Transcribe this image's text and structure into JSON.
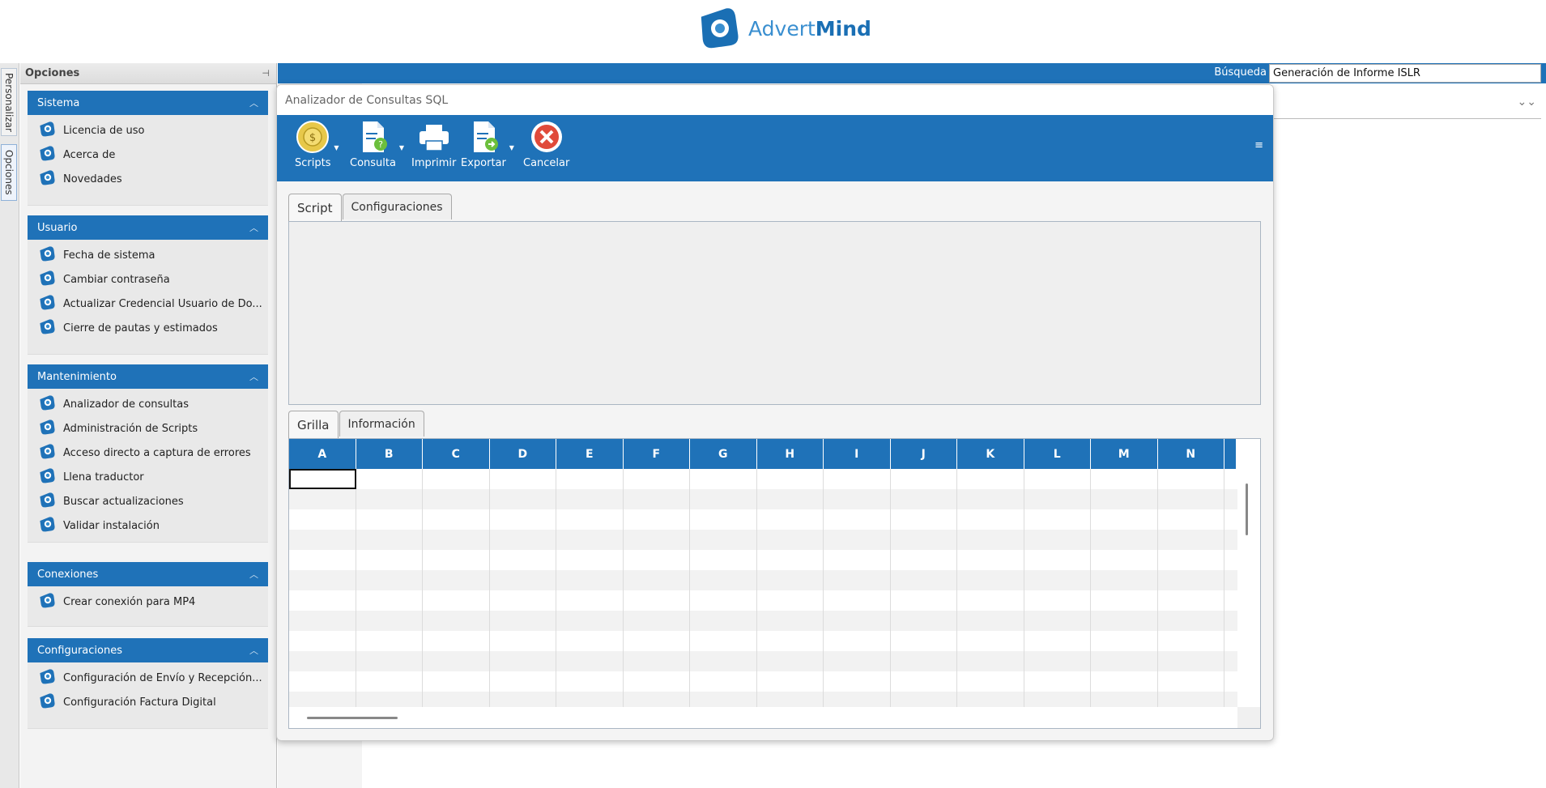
{
  "header": {
    "logo_advert": "Advert",
    "logo_mind": "Mind"
  },
  "vtabs": {
    "personalizar": "Personalizar",
    "opciones": "Opciones"
  },
  "options": {
    "title": "Opciones",
    "groups": [
      {
        "title": "Sistema",
        "items": [
          "Licencia de uso",
          "Acerca de",
          "Novedades"
        ]
      },
      {
        "title": "Usuario",
        "items": [
          "Fecha de sistema",
          "Cambiar contraseña",
          "Actualizar Credencial Usuario de Do...",
          "Cierre de pautas y estimados"
        ]
      },
      {
        "title": "Mantenimiento",
        "items": [
          "Analizador de consultas",
          "Administración de Scripts",
          "Acceso directo a captura de errores",
          "Llena traductor",
          "Buscar actualizaciones",
          "Validar instalación"
        ]
      },
      {
        "title": "Conexiones",
        "items": [
          "Crear conexión para MP4"
        ]
      },
      {
        "title": "Configuraciones",
        "items": [
          "Configuración de Envío y Recepción...",
          "Configuración Factura Digital"
        ]
      }
    ]
  },
  "search": {
    "label": "Búsqueda",
    "value": "Generación de Informe ISLR"
  },
  "sql_window": {
    "title": "Analizador de Consultas SQL",
    "toolbar": {
      "scripts": "Scripts",
      "consulta": "Consulta",
      "imprimir": "Imprimir",
      "exportar": "Exportar",
      "cancelar": "Cancelar"
    },
    "script_tabs": [
      "Script",
      "Configuraciones"
    ],
    "result_tabs": [
      "Grilla",
      "Información"
    ],
    "grid_columns": [
      "A",
      "B",
      "C",
      "D",
      "E",
      "F",
      "G",
      "H",
      "I",
      "J",
      "K",
      "L",
      "M",
      "N"
    ]
  },
  "colors": {
    "accent": "#1f72b8",
    "logo_light": "#3a8fd0"
  }
}
